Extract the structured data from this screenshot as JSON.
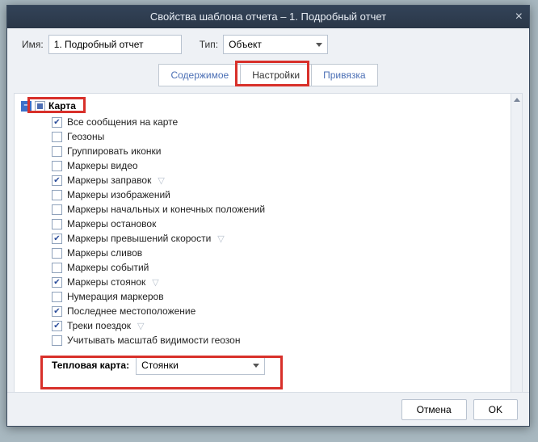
{
  "dialog": {
    "title": "Свойства шаблона отчета – 1. Подробный отчет"
  },
  "header": {
    "name_label": "Имя:",
    "name_value": "1. Подробный отчет",
    "type_label": "Тип:",
    "type_value": "Объект"
  },
  "tabs": {
    "content": "Содержимое",
    "settings": "Настройки",
    "binding": "Привязка"
  },
  "group": {
    "title": "Карта",
    "collapse_glyph": "–"
  },
  "items": [
    {
      "label": "Все сообщения на карте",
      "checked": true,
      "filter": false
    },
    {
      "label": "Геозоны",
      "checked": false,
      "filter": false
    },
    {
      "label": "Группировать иконки",
      "checked": false,
      "filter": false
    },
    {
      "label": "Маркеры видео",
      "checked": false,
      "filter": false
    },
    {
      "label": "Маркеры заправок",
      "checked": true,
      "filter": true
    },
    {
      "label": "Маркеры изображений",
      "checked": false,
      "filter": false
    },
    {
      "label": "Маркеры начальных и конечных положений",
      "checked": false,
      "filter": false
    },
    {
      "label": "Маркеры остановок",
      "checked": false,
      "filter": false
    },
    {
      "label": "Маркеры превышений скорости",
      "checked": true,
      "filter": true
    },
    {
      "label": "Маркеры сливов",
      "checked": false,
      "filter": false
    },
    {
      "label": "Маркеры событий",
      "checked": false,
      "filter": false
    },
    {
      "label": "Маркеры стоянок",
      "checked": true,
      "filter": true
    },
    {
      "label": "Нумерация маркеров",
      "checked": false,
      "filter": false
    },
    {
      "label": "Последнее местоположение",
      "checked": true,
      "filter": false
    },
    {
      "label": "Треки поездок",
      "checked": true,
      "filter": true
    },
    {
      "label": "Учитывать масштаб видимости геозон",
      "checked": false,
      "filter": false
    }
  ],
  "heatmap": {
    "label": "Тепловая карта:",
    "value": "Стоянки"
  },
  "footer": {
    "cancel": "Отмена",
    "ok": "OK"
  }
}
